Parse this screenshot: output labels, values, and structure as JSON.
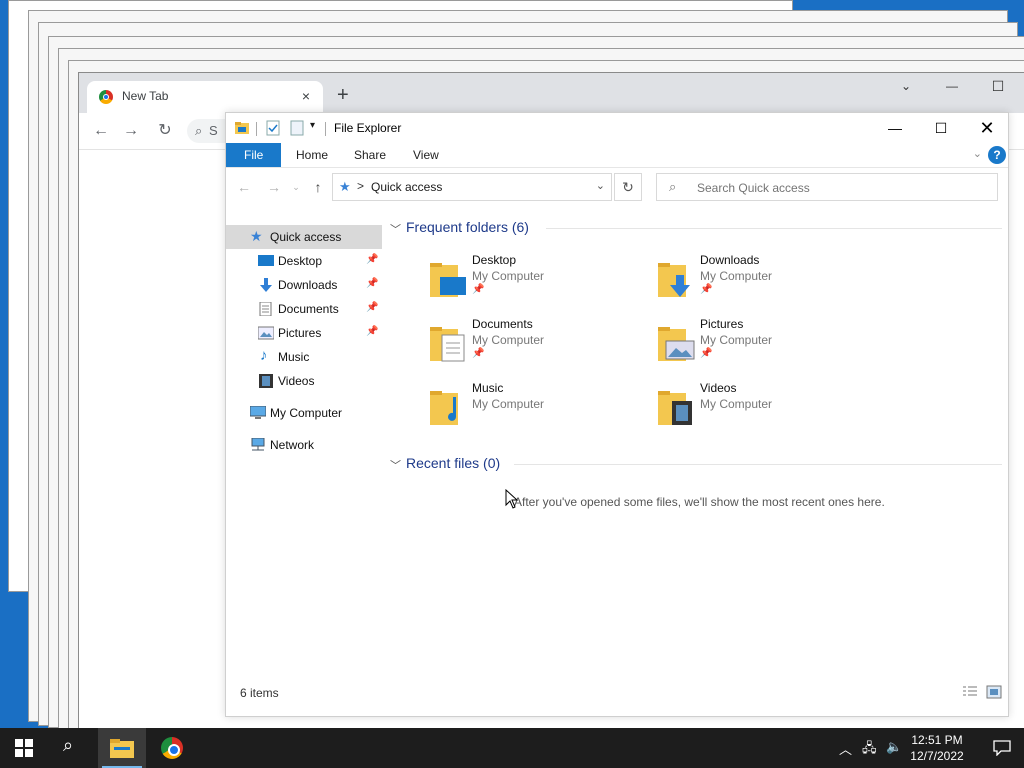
{
  "chrome": {
    "tab_title": "New Tab",
    "tab_close": "×",
    "new_tab": "+",
    "omnibox_stub": "S",
    "minimize": "—",
    "maximize": "☐",
    "menu": "⌄"
  },
  "explorer": {
    "title": "File Explorer",
    "ribbon": {
      "file": "File",
      "home": "Home",
      "share": "Share",
      "view": "View",
      "help": "?"
    },
    "address": {
      "separator": ">",
      "location": "Quick access"
    },
    "search": {
      "placeholder": "Search Quick access"
    },
    "nav": {
      "quick_access": "Quick access",
      "desktop": "Desktop",
      "downloads": "Downloads",
      "documents": "Documents",
      "pictures": "Pictures",
      "music": "Music",
      "videos": "Videos",
      "my_computer": "My Computer",
      "network": "Network"
    },
    "frequent": {
      "header": "Frequent folders (6)",
      "items": [
        {
          "name": "Desktop",
          "location": "My Computer"
        },
        {
          "name": "Downloads",
          "location": "My Computer"
        },
        {
          "name": "Documents",
          "location": "My Computer"
        },
        {
          "name": "Pictures",
          "location": "My Computer"
        },
        {
          "name": "Music",
          "location": "My Computer"
        },
        {
          "name": "Videos",
          "location": "My Computer"
        }
      ]
    },
    "recent": {
      "header": "Recent files (0)",
      "empty_message": "After you've opened some files, we'll show the most recent ones here."
    },
    "status": {
      "items": "6 items"
    }
  },
  "taskbar": {
    "time": "12:51 PM",
    "date": "12/7/2022"
  },
  "colors": {
    "accent": "#1979ca",
    "desktop": "#1a6fc4",
    "taskbar": "#1d1d1d",
    "folder": "#f3c74f"
  }
}
